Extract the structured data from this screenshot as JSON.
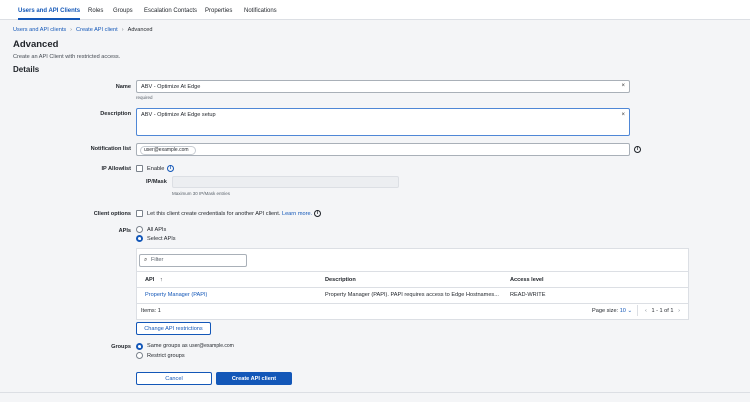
{
  "tabs": [
    {
      "label": "Users and API Clients",
      "active": true
    },
    {
      "label": "Roles"
    },
    {
      "label": "Groups"
    },
    {
      "label": "Escalation Contacts"
    },
    {
      "label": "Properties"
    },
    {
      "label": "Notifications"
    }
  ],
  "breadcrumb": [
    "Users and API clients",
    "Create API client",
    "Advanced"
  ],
  "page": {
    "title": "Advanced",
    "subtitle": "Create an API Client with restricted access.",
    "section": "Details"
  },
  "form": {
    "name_label": "Name",
    "name_value": "ABV - Optimize At Edge",
    "name_hint": "required",
    "description_label": "Description",
    "description_value": "ABV - Optimize At Edge setup",
    "notification_label": "Notification list",
    "notification_chip": "user@example.com",
    "ip_label": "IP Allowlist",
    "ip_enable": "Enable",
    "ip_mask_label": "IP/Mask",
    "ip_hint": "Maximum 30 IP/Mask entries",
    "client_label": "Client options",
    "client_text": "Let this client create credentials for another API client.",
    "learn_more": "Learn more.",
    "apis_label": "APIs",
    "apis_all": "All APIs",
    "apis_select": "Select APIs",
    "groups_label": "Groups",
    "groups_same": "Same groups as",
    "groups_same_user": "user@example.com",
    "groups_restrict": "Restrict groups"
  },
  "table": {
    "filter_placeholder": "Filter",
    "columns": [
      "API",
      "Description",
      "Access level"
    ],
    "sort_indicator": "↑",
    "rows": [
      {
        "api": "Property Manager (PAPI)",
        "description": "Property Manager (PAPI). PAPI requires access to Edge Hostnames...",
        "access": "READ-WRITE"
      }
    ],
    "items": "Items: 1",
    "page_size_label": "Page size:",
    "page_size": "10",
    "pager": "1 - 1 of 1"
  },
  "buttons": {
    "change": "Change API restrictions",
    "cancel": "Cancel",
    "create": "Create API client"
  },
  "colors": {
    "accent": "#1357b8"
  }
}
